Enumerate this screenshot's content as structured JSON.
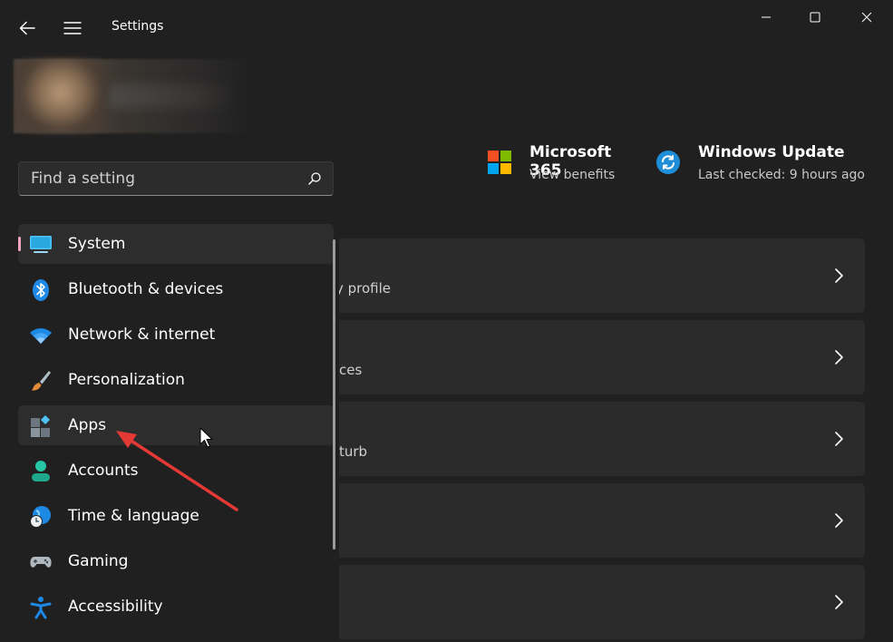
{
  "window": {
    "title": "Settings"
  },
  "search": {
    "placeholder": "Find a setting"
  },
  "header_cards": [
    {
      "title": "Microsoft 365",
      "subtitle": "View benefits",
      "icon": "microsoft-logo-icon"
    },
    {
      "title": "Windows Update",
      "subtitle": "Last checked: 9 hours ago",
      "icon": "windows-update-icon"
    }
  ],
  "nav": {
    "selected": "System",
    "hovered": "Apps",
    "items": [
      {
        "label": "System",
        "icon": "system-monitor-icon"
      },
      {
        "label": "Bluetooth & devices",
        "icon": "bluetooth-icon"
      },
      {
        "label": "Network & internet",
        "icon": "wifi-icon"
      },
      {
        "label": "Personalization",
        "icon": "paintbrush-icon"
      },
      {
        "label": "Apps",
        "icon": "apps-icon"
      },
      {
        "label": "Accounts",
        "icon": "person-icon"
      },
      {
        "label": "Time & language",
        "icon": "globe-clock-icon"
      },
      {
        "label": "Gaming",
        "icon": "gamepad-icon"
      },
      {
        "label": "Accessibility",
        "icon": "accessibility-icon"
      }
    ]
  },
  "content_cards": [
    {
      "visible_text": "y profile"
    },
    {
      "visible_text": "ces"
    },
    {
      "visible_text": "turb"
    },
    {
      "visible_text": ""
    },
    {
      "visible_text": ""
    }
  ],
  "annotation": {
    "type": "red-arrow",
    "color": "#e53935",
    "points_to": "Apps"
  },
  "colors": {
    "background": "#202020",
    "card": "#2b2b2b",
    "selection_indicator": "#f5a7bd",
    "accent": "#0078d4"
  }
}
